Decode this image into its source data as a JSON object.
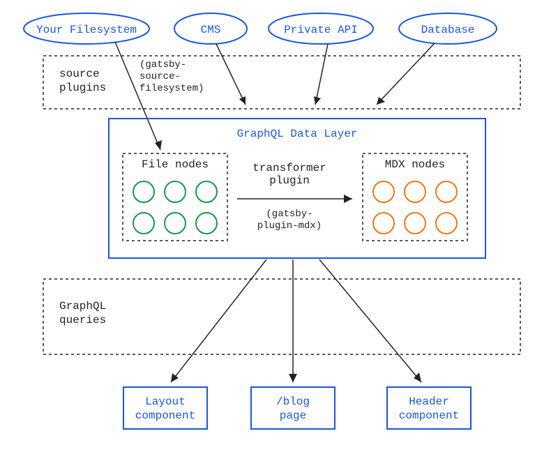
{
  "sources": {
    "filesystem": "Your Filesystem",
    "cms": "CMS",
    "private_api": "Private API",
    "database": "Database"
  },
  "source_plugins": {
    "title_l1": "source",
    "title_l2": "plugins",
    "fs_plugin_l1": "(gatsby-",
    "fs_plugin_l2": "source-",
    "fs_plugin_l3": "filesystem)"
  },
  "data_layer": {
    "title": "GraphQL Data Layer",
    "file_nodes": "File nodes",
    "mdx_nodes": "MDX nodes",
    "transformer_l1": "transformer",
    "transformer_l2": "plugin",
    "mdx_plugin_l1": "(gatsby-",
    "mdx_plugin_l2": "plugin-mdx)"
  },
  "queries": {
    "title_l1": "GraphQL",
    "title_l2": "queries"
  },
  "components": {
    "layout_l1": "Layout",
    "layout_l2": "component",
    "blog_l1": "/blog",
    "blog_l2": "page",
    "header_l1": "Header",
    "header_l2": "component"
  },
  "colors": {
    "blue": "#1a56db",
    "green": "#1a9642",
    "orange": "#e67a17",
    "text": "#222222"
  }
}
